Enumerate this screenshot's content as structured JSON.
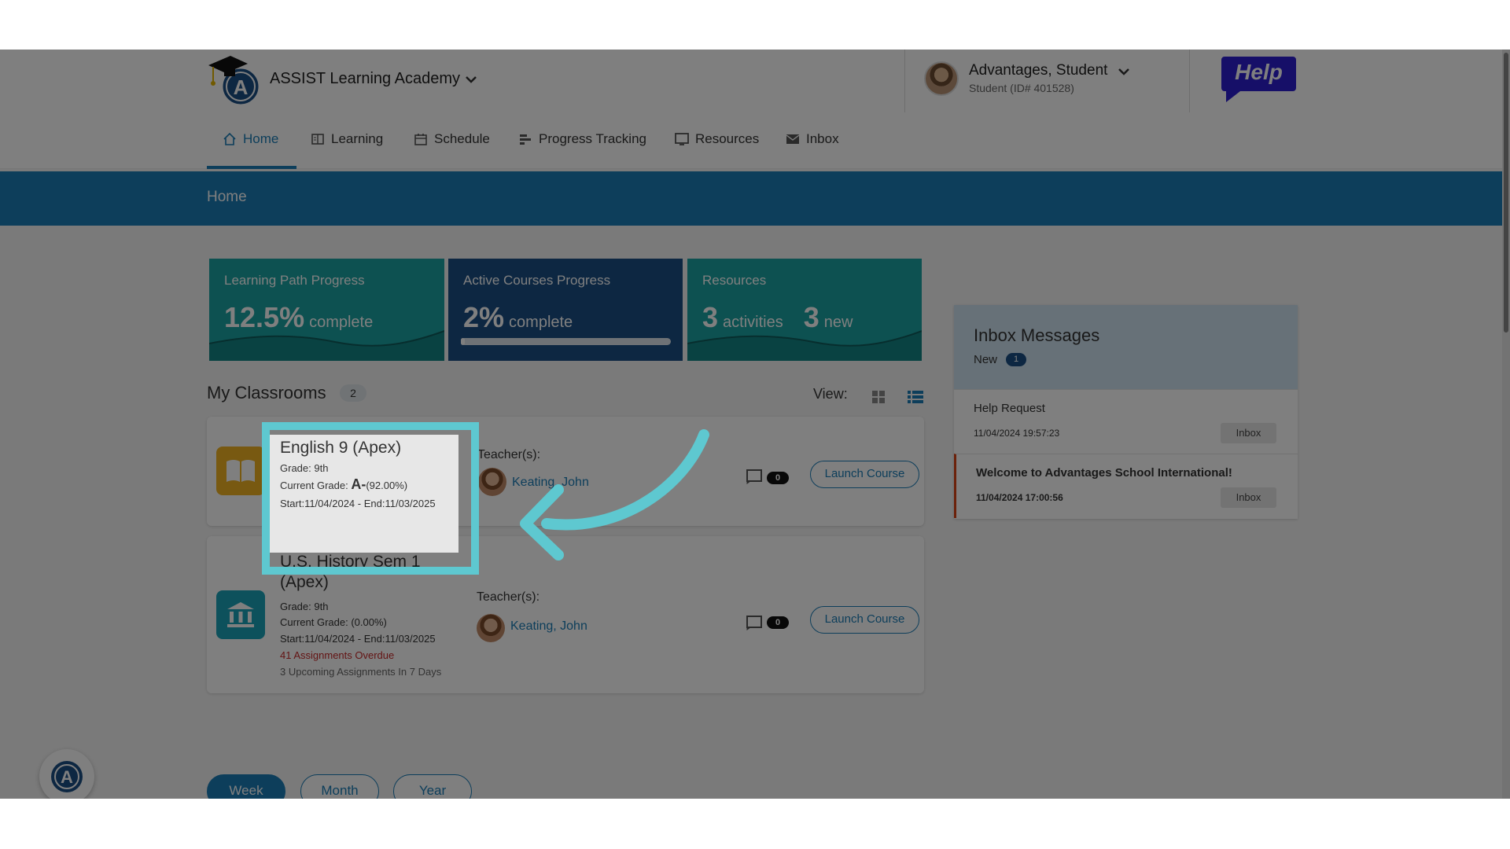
{
  "header": {
    "school_name": "ASSIST Learning Academy",
    "user_name": "Advantages, Student",
    "user_id": "Student (ID# 401528)",
    "help_label": "Help"
  },
  "nav": {
    "items": [
      {
        "label": "Home",
        "icon": "home-icon"
      },
      {
        "label": "Learning",
        "icon": "book-icon"
      },
      {
        "label": "Schedule",
        "icon": "calendar-icon"
      },
      {
        "label": "Progress Tracking",
        "icon": "chart-bars-icon"
      },
      {
        "label": "Resources",
        "icon": "monitor-icon"
      },
      {
        "label": "Inbox",
        "icon": "envelope-icon"
      }
    ],
    "active": "Home"
  },
  "banner": {
    "title": "Home"
  },
  "stats": [
    {
      "label": "Learning Path Progress",
      "value": "12.5%",
      "unit": "complete",
      "color": "#1aa3a3"
    },
    {
      "label": "Active Courses Progress",
      "value": "2%",
      "unit": "complete",
      "progress": 0.02,
      "color": "#1b4f85"
    },
    {
      "label": "Resources",
      "value1": "3",
      "unit1": "activities",
      "value2": "3",
      "unit2": "new",
      "color": "#1aa3a3"
    }
  ],
  "classrooms": {
    "title": "My Classrooms",
    "count": "2",
    "view_label": "View:",
    "courses": [
      {
        "title": "English 9 (Apex)",
        "grade": "Grade: 9th",
        "current_grade_label": "Current Grade:",
        "current_grade_letter": "A-",
        "current_grade_pct": "(92.00%)",
        "dates": "Start:11/04/2024 - End:11/03/2025",
        "teacher_label": "Teacher(s):",
        "teacher_name": "Keating, John",
        "message_count": "0",
        "launch_label": "Launch Course",
        "icon": "open-book-icon",
        "icon_color": "#f0b323"
      },
      {
        "title": "U.S. History Sem 1 (Apex)",
        "grade": "Grade: 9th",
        "current_grade_label": "Current Grade:",
        "current_grade_pct": "(0.00%)",
        "dates": "Start:11/04/2024 - End:11/03/2025",
        "overdue": "41 Assignments Overdue",
        "upcoming": "3 Upcoming Assignments In 7 Days",
        "teacher_label": "Teacher(s):",
        "teacher_name": "Keating, John",
        "message_count": "0",
        "launch_label": "Launch Course",
        "icon": "bank-building-icon",
        "icon_color": "#1aa3b8"
      }
    ]
  },
  "time_filter": {
    "options": [
      "Week",
      "Month",
      "Year"
    ],
    "active": "Week"
  },
  "inbox": {
    "title": "Inbox Messages",
    "new_label": "New",
    "new_count": "1",
    "messages": [
      {
        "subject": "Help Request",
        "date": "11/04/2024 19:57:23",
        "button": "Inbox",
        "unread": false
      },
      {
        "subject": "Welcome to Advantages School International!",
        "date": "11/04/2024 17:00:56",
        "button": "Inbox",
        "unread": true
      }
    ]
  },
  "colors": {
    "brand": "#1b7db6",
    "teal": "#1aa3a3",
    "navy": "#1b4f85",
    "highlight": "#5ec8d0"
  }
}
